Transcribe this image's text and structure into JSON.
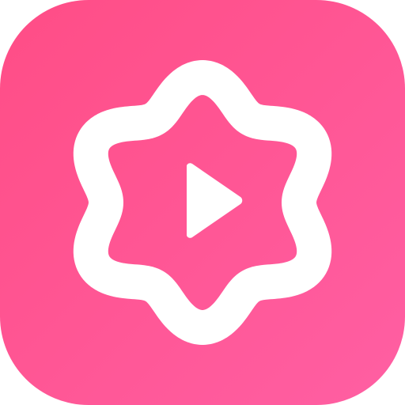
{
  "icon": {
    "name": "play-badge-app-icon",
    "colors": {
      "gradient_start": "#FF4D86",
      "gradient_end": "#FF5FA3",
      "badge_outline": "#FFFFFF",
      "play_symbol": "#FFFFFF"
    },
    "symbols": [
      "flower-badge",
      "play"
    ]
  }
}
